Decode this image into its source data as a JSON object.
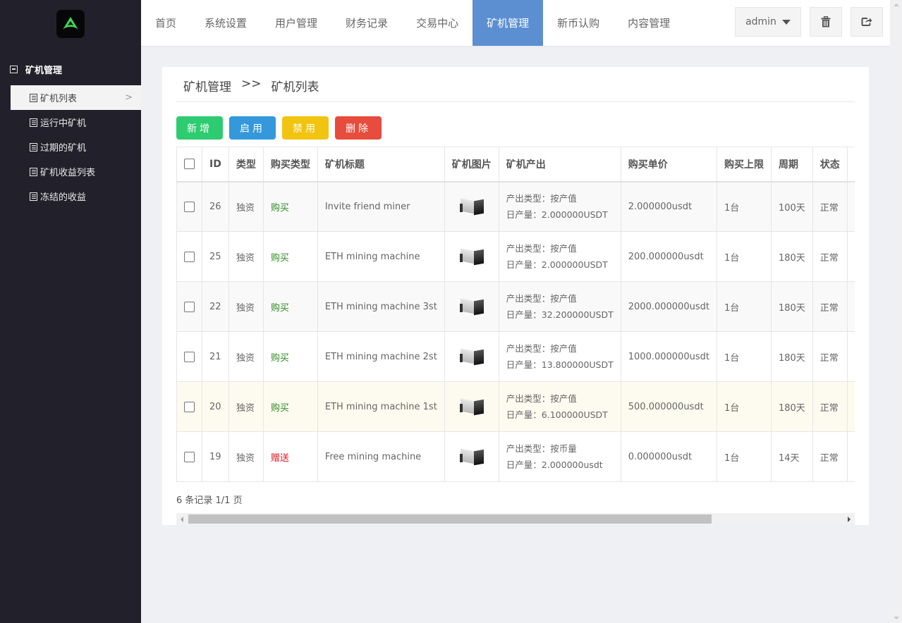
{
  "sidebar": {
    "group_title": "矿机管理",
    "items": [
      {
        "label": "矿机列表",
        "active": true
      },
      {
        "label": "运行中矿机",
        "active": false
      },
      {
        "label": "过期的矿机",
        "active": false
      },
      {
        "label": "矿机收益列表",
        "active": false
      },
      {
        "label": "冻结的收益",
        "active": false
      }
    ]
  },
  "topnav": {
    "items": [
      {
        "label": "首页",
        "active": false
      },
      {
        "label": "系统设置",
        "active": false
      },
      {
        "label": "用户管理",
        "active": false
      },
      {
        "label": "财务记录",
        "active": false
      },
      {
        "label": "交易中心",
        "active": false
      },
      {
        "label": "矿机管理",
        "active": true
      },
      {
        "label": "新币认购",
        "active": false
      },
      {
        "label": "内容管理",
        "active": false
      }
    ],
    "user": "admin",
    "icons": [
      "trash-icon",
      "logout-icon"
    ]
  },
  "breadcrumb": {
    "parent": "矿机管理",
    "separator": ">>",
    "current": "矿机列表"
  },
  "toolbar": {
    "add": {
      "label": "新增",
      "color": "#2ecc71"
    },
    "enable": {
      "label": "启用",
      "color": "#3498db"
    },
    "disable": {
      "label": "禁用",
      "color": "#f1c40f"
    },
    "delete": {
      "label": "删除",
      "color": "#e74c3c"
    }
  },
  "table": {
    "headers": [
      "ID",
      "类型",
      "购买类型",
      "矿机标题",
      "矿机图片",
      "矿机产出",
      "购买单价",
      "购买上限",
      "周期",
      "状态"
    ],
    "rows": [
      {
        "id": "26",
        "type": "独资",
        "buy_type": "购买",
        "buy_type_color": "green",
        "title": "Invite friend miner",
        "output_type": "产出类型：按产值",
        "daily_output": "日产量：2.000000USDT",
        "price": "2.000000usdt",
        "limit": "1台",
        "period": "100天",
        "status": "正常"
      },
      {
        "id": "25",
        "type": "独资",
        "buy_type": "购买",
        "buy_type_color": "green",
        "title": "ETH mining machine",
        "output_type": "产出类型：按产值",
        "daily_output": "日产量：2.000000USDT",
        "price": "200.000000usdt",
        "limit": "1台",
        "period": "180天",
        "status": "正常"
      },
      {
        "id": "22",
        "type": "独资",
        "buy_type": "购买",
        "buy_type_color": "green",
        "title": "ETH mining machine 3st",
        "output_type": "产出类型：按产值",
        "daily_output": "日产量：32.200000USDT",
        "price": "2000.000000usdt",
        "limit": "1台",
        "period": "180天",
        "status": "正常"
      },
      {
        "id": "21",
        "type": "独资",
        "buy_type": "购买",
        "buy_type_color": "green",
        "title": "ETH mining machine 2st",
        "output_type": "产出类型：按产值",
        "daily_output": "日产量：13.800000USDT",
        "price": "1000.000000usdt",
        "limit": "1台",
        "period": "180天",
        "status": "正常"
      },
      {
        "id": "20",
        "type": "独资",
        "buy_type": "购买",
        "buy_type_color": "green",
        "title": "ETH mining machine 1st",
        "output_type": "产出类型：按产值",
        "daily_output": "日产量：6.100000USDT",
        "price": "500.000000usdt",
        "limit": "1台",
        "period": "180天",
        "status": "正常"
      },
      {
        "id": "19",
        "type": "独资",
        "buy_type": "赠送",
        "buy_type_color": "red",
        "title": "Free mining machine",
        "output_type": "产出类型：按币量",
        "daily_output": "日产量：2.000000usdt",
        "price": "0.000000usdt",
        "limit": "1台",
        "period": "14天",
        "status": "正常"
      }
    ]
  },
  "footer": {
    "summary": "6 条记录 1/1 页"
  },
  "horizontal_scroll_fraction": 0.8
}
